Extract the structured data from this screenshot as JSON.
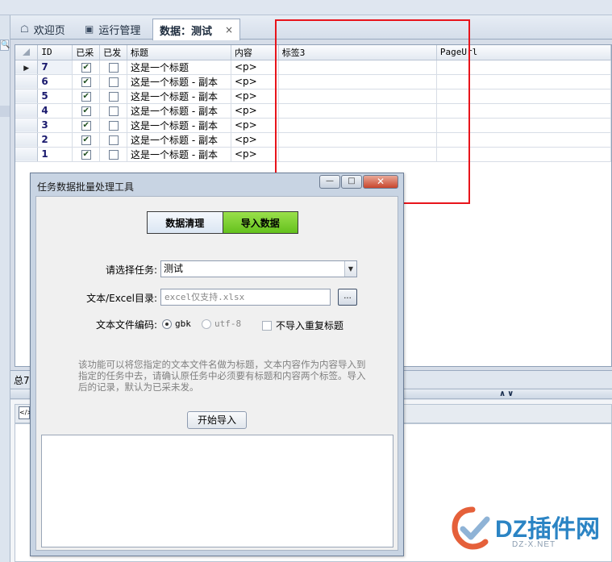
{
  "tabs": [
    {
      "label": "欢迎页",
      "icon": "home-icon"
    },
    {
      "label": "运行管理",
      "icon": "monitor-icon"
    },
    {
      "label": "数据：测试",
      "icon": "",
      "close": "×"
    }
  ],
  "grid": {
    "columns": [
      "ID",
      "已采",
      "已发",
      "标题",
      "内容",
      "标签3",
      "PageUrl"
    ],
    "rows": [
      {
        "id": "7",
        "collected": true,
        "published": false,
        "title": "这是一个标题",
        "content": "<p>"
      },
      {
        "id": "6",
        "collected": true,
        "published": false,
        "title": "这是一个标题 - 副本",
        "content": "<p>"
      },
      {
        "id": "5",
        "collected": true,
        "published": false,
        "title": "这是一个标题 - 副本",
        "content": "<p>"
      },
      {
        "id": "4",
        "collected": true,
        "published": false,
        "title": "这是一个标题 - 副本",
        "content": "<p>"
      },
      {
        "id": "3",
        "collected": true,
        "published": false,
        "title": "这是一个标题 - 副本",
        "content": "<p>"
      },
      {
        "id": "2",
        "collected": true,
        "published": false,
        "title": "这是一个标题 - 副本",
        "content": "<p>"
      },
      {
        "id": "1",
        "collected": true,
        "published": false,
        "title": "这是一个标题 - 副本",
        "content": "<p>"
      }
    ]
  },
  "statusbar": {
    "text": "总7"
  },
  "dialog": {
    "title": "任务数据批量处理工具",
    "segment_clean": "数据清理",
    "segment_import": "导入数据",
    "task_label": "请选择任务:",
    "task_value": "测试",
    "dir_label": "文本/Excel目录:",
    "dir_placeholder": "excel仅支持.xlsx",
    "browse_label": "...",
    "encoding_label": "文本文件编码:",
    "encoding_gbk": "gbk",
    "encoding_utf8": "utf-8",
    "dedupe_label": "不导入重复标题",
    "description": "该功能可以将您指定的文本文件名做为标题，文本内容作为内容导入到指定的任务中去，请确认原任务中必须要有标题和内容两个标签。导入后的记录，默认为已采未发。",
    "start_button": "开始导入"
  },
  "watermark": {
    "brand": "DZ插件网",
    "domain": "DZ-X.NET"
  },
  "colors": {
    "highlight": "#e8141b",
    "import_tab": "#7ed133",
    "brand": "#2b84c4"
  }
}
